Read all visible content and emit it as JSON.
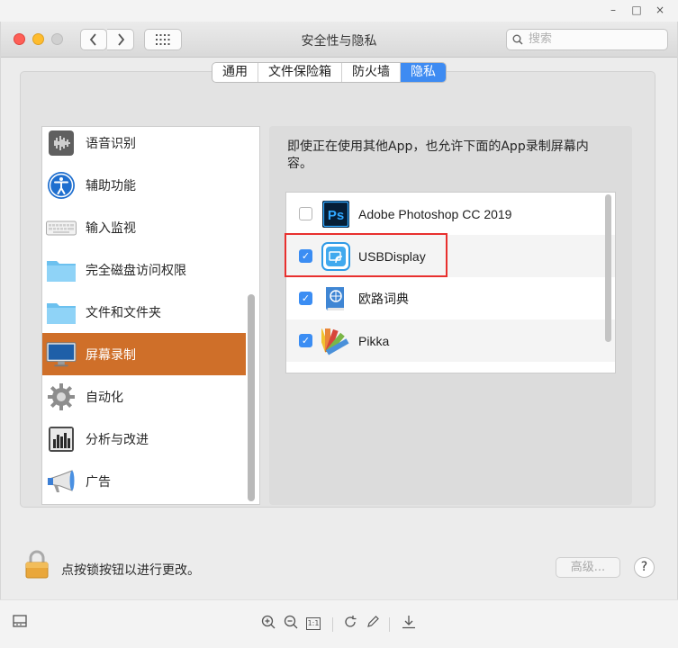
{
  "viewer": {
    "minimize": "–",
    "maximize": "□",
    "close": "×",
    "toolbar": [
      "zoom-in-icon",
      "zoom-out-icon",
      "actual-size-icon",
      "rotate-icon",
      "edit-icon",
      "download-icon"
    ],
    "actual_size_label": "1:1"
  },
  "window": {
    "title": "安全性与隐私",
    "search_placeholder": "搜索"
  },
  "tabs": [
    "通用",
    "文件保险箱",
    "防火墙",
    "隐私"
  ],
  "active_tab": "隐私",
  "sidebar": {
    "items": [
      {
        "label": "语音识别",
        "icon": "speech-waveform-icon"
      },
      {
        "label": "辅助功能",
        "icon": "accessibility-icon"
      },
      {
        "label": "输入监视",
        "icon": "keyboard-icon"
      },
      {
        "label": "完全磁盘访问权限",
        "icon": "folder-icon"
      },
      {
        "label": "文件和文件夹",
        "icon": "folder-icon"
      },
      {
        "label": "屏幕录制",
        "icon": "monitor-icon"
      },
      {
        "label": "自动化",
        "icon": "gear-icon"
      },
      {
        "label": "分析与改进",
        "icon": "bar-chart-icon"
      },
      {
        "label": "广告",
        "icon": "megaphone-icon"
      }
    ],
    "selected_index": 5
  },
  "right": {
    "description": "即使正在使用其他App，也允许下面的App录制屏幕内容。",
    "apps": [
      {
        "name": "Adobe Photoshop CC 2019",
        "checked": false,
        "icon": "photoshop-icon",
        "badge": "Ps"
      },
      {
        "name": "USBDisplay",
        "checked": true,
        "icon": "usbdisplay-icon"
      },
      {
        "name": "欧路词典",
        "checked": true,
        "icon": "eudic-dictionary-icon"
      },
      {
        "name": "Pikka",
        "checked": true,
        "icon": "pikka-color-swatch-icon"
      }
    ],
    "highlighted_app": "USBDisplay"
  },
  "footer": {
    "lock_text": "点按锁按钮以进行更改。",
    "advanced_label": "高级...",
    "help_label": "?"
  },
  "colors": {
    "accent": "#3e8bf2",
    "selection": "#cf6f29",
    "highlight_box": "#e8302e"
  }
}
